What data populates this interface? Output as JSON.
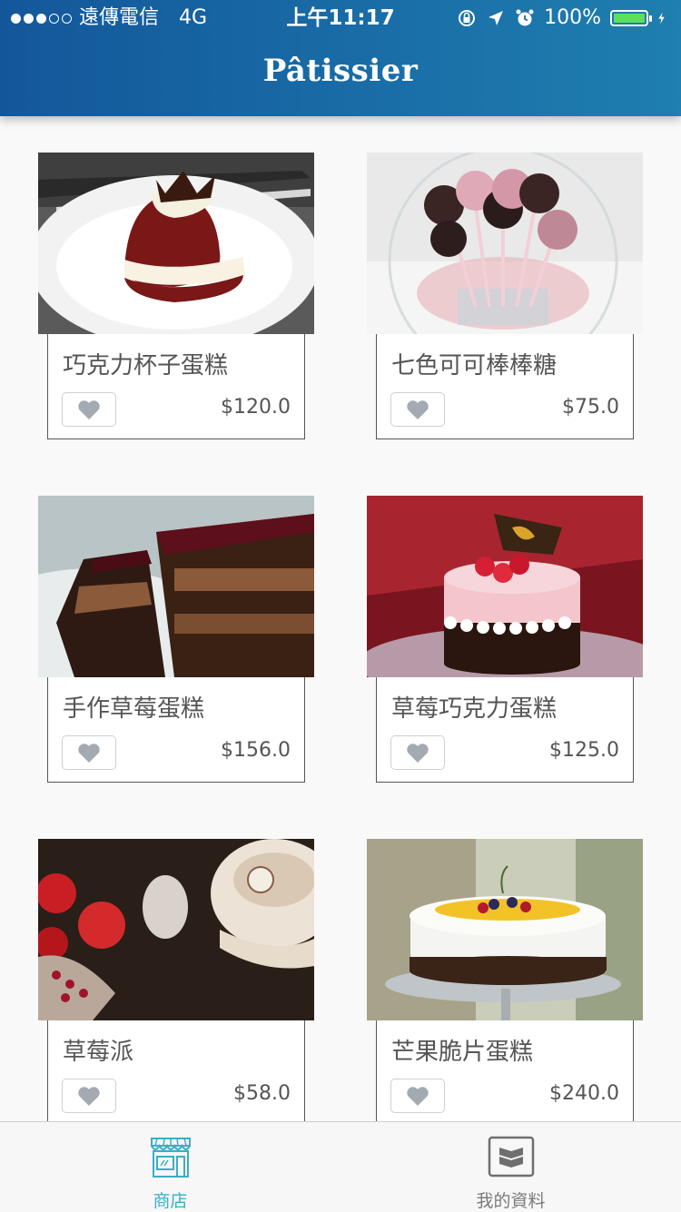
{
  "status_bar": {
    "carrier": "遠傳電信",
    "network": "4G",
    "time": "上午11:17",
    "battery": "100%",
    "battery_color": "#5ce05c",
    "signal_bars_filled": 3,
    "signal_bars_total": 5
  },
  "nav": {
    "title": "Pâtissier"
  },
  "theme": {
    "nav_bg": "#1a6fa8",
    "accent": "#3aaec8",
    "heart_gray": "#a4aab2"
  },
  "products": [
    {
      "name": "巧克力杯子蛋糕",
      "price": "$120.0",
      "image_icon": "red-velvet-cupcake-photo"
    },
    {
      "name": "七色可可棒棒糖",
      "price": "$75.0",
      "image_icon": "cake-pops-photo"
    },
    {
      "name": "手作草莓蛋糕",
      "price": "$156.0",
      "image_icon": "chocolate-layer-cake-photo"
    },
    {
      "name": "草莓巧克力蛋糕",
      "price": "$125.0",
      "image_icon": "strawberry-mousse-cake-photo"
    },
    {
      "name": "草莓派",
      "price": "$58.0",
      "image_icon": "strawberries-tableware-photo"
    },
    {
      "name": "芒果脆片蛋糕",
      "price": "$240.0",
      "image_icon": "mango-fruit-cake-photo"
    }
  ],
  "tab_bar": {
    "tabs": [
      {
        "label": "商店",
        "icon": "shop-icon",
        "active": true
      },
      {
        "label": "我的資料",
        "icon": "profile-book-icon",
        "active": false
      }
    ]
  }
}
